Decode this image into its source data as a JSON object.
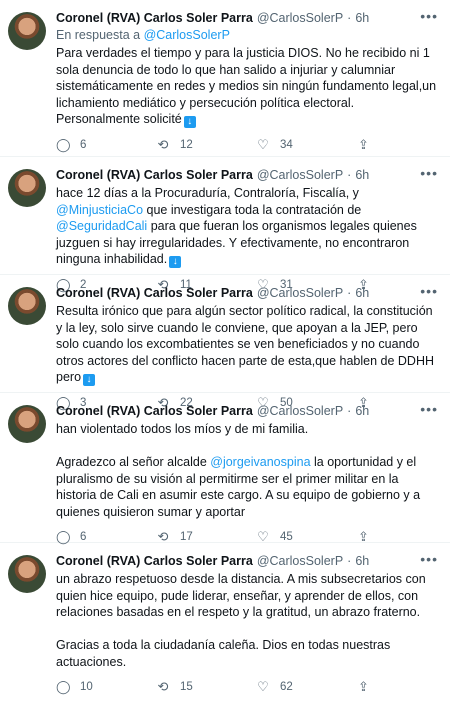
{
  "tweets": [
    {
      "name": "Coronel (RVA) Carlos Soler Parra",
      "handle": "@CarlosSolerP",
      "time": "6h",
      "reply_prefix": "En respuesta a",
      "reply_handle": "@CarlosSolerP",
      "parts": [
        "Para verdades el tiempo y para la justicia DIOS. No he recibido ni 1 sola denuncia de todo lo que han salido a injuriar y calumniar sistemáticamente en redes y medios sin ningún fundamento legal,un lichamiento mediático y persecución política electoral.\nPersonalmente solicité"
      ],
      "arrow": true,
      "replies": "6",
      "retweets": "12",
      "likes": "34"
    },
    {
      "name": "Coronel (RVA) Carlos Soler Parra",
      "handle": "@CarlosSolerP",
      "time": "6h",
      "text_a": "hace 12 días a la Procuraduría, Contraloría, Fiscalía, y ",
      "mention_a": "@MinjusticiaCo",
      "text_b": " que investigara toda la contratación de ",
      "mention_b": "@SeguridadCali",
      "text_c": " para que fueran los organismos legales quienes juzguen si hay irregularidades. Y efectivamente, no encontraron ninguna inhabilidad.",
      "arrow": true,
      "replies": "2",
      "retweets": "11",
      "likes": "31"
    },
    {
      "name": "Coronel (RVA) Carlos Soler Parra",
      "handle": "@CarlosSolerP",
      "time": "6h",
      "text": "Resulta irónico que para algún sector político radical, la constitución y la ley, solo sirve cuando le conviene, que apoyan a la JEP, pero solo cuando los excombatientes se ven beneficiados y no cuando otros actores del conflicto hacen parte de esta,que hablen de DDHH pero",
      "arrow": true,
      "replies": "3",
      "retweets": "22",
      "likes": "50"
    },
    {
      "name": "Coronel (RVA) Carlos Soler Parra",
      "handle": "@CarlosSolerP",
      "time": "6h",
      "text_a": "han violentado todos los míos y de mi familia.\n\nAgradezco al señor alcalde ",
      "mention_a": "@jorgeivanospina",
      "text_b": " la oportunidad y el pluralismo de su visión al permitirme ser el primer militar en la historia de Cali en asumir este cargo. A su equipo de gobierno y a quienes quisieron sumar y aportar",
      "replies": "6",
      "retweets": "17",
      "likes": "45"
    },
    {
      "name": "Coronel (RVA) Carlos Soler Parra",
      "handle": "@CarlosSolerP",
      "time": "6h",
      "text": "un abrazo respetuoso desde la distancia. A mis subsecretarios con quien hice equipo, pude liderar, enseñar, y aprender de ellos, con relaciones basadas en el respeto y la gratitud, un abrazo fraterno.\n\nGracias a toda la ciudadanía caleña. Dios en todas nuestras actuaciones.",
      "replies": "10",
      "retweets": "15",
      "likes": "62"
    }
  ],
  "icons": {
    "more": "more-icon",
    "reply": "reply-icon",
    "retweet": "retweet-icon",
    "like": "heart-icon",
    "share": "share-icon",
    "arrow": "arrow-down-icon"
  },
  "colors": {
    "link": "#1d9bf0",
    "muted": "#536471",
    "text": "#0f1419"
  }
}
